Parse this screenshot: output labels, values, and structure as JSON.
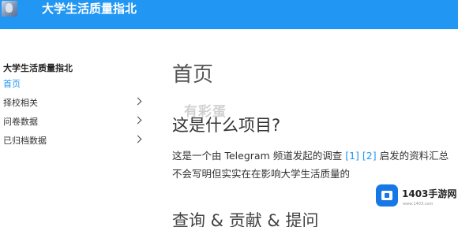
{
  "header": {
    "site_title": "大学生活质量指北",
    "bar_color": "#2196f3"
  },
  "sidebar": {
    "title": "大学生活质量指北",
    "items": [
      {
        "label": "首页",
        "active": true,
        "expandable": false
      },
      {
        "label": "择校相关",
        "active": false,
        "expandable": true
      },
      {
        "label": "问卷数据",
        "active": false,
        "expandable": true
      },
      {
        "label": "已归档数据",
        "active": false,
        "expandable": true
      }
    ]
  },
  "main": {
    "page_title": "首页",
    "section1_title": "这是什么项目?",
    "paragraph": {
      "line1_before": "这是一个由 Telegram 频道发起的调查 ",
      "link1": "[1]",
      "link2": "[2]",
      "line1_after": " 启发的资料汇总",
      "line2": "不会写明但实实在在影响大学生活质量的"
    },
    "section2_title": "查询 & 贡献 & 提问"
  },
  "watermarks": {
    "overlay_text": "有彩蛋",
    "brand": "1403手游网",
    "url": "www.1403.com"
  }
}
